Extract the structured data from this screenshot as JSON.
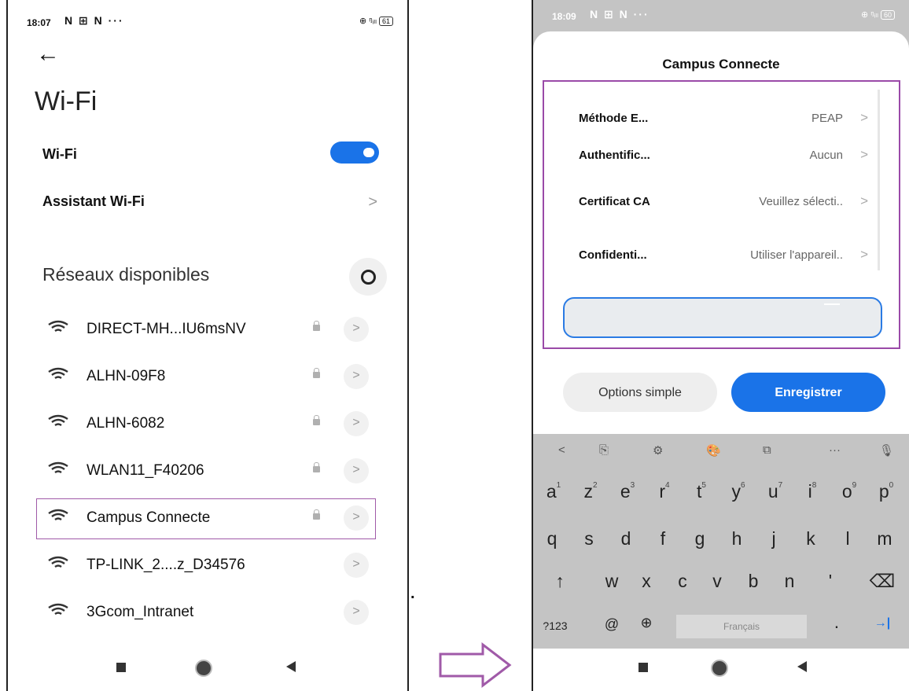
{
  "left_phone": {
    "status": {
      "time": "18:07",
      "icons": "N ⊞ N ···",
      "right_icons": "⊕ ᵑᵢₗₗ",
      "battery": "61"
    },
    "back_label": "←",
    "title": "Wi-Fi",
    "wifi_row": {
      "label": "Wi-Fi",
      "enabled": true
    },
    "assistant": {
      "label": "Assistant Wi-Fi",
      "chevron": ">"
    },
    "networks_title": "Réseaux disponibles",
    "networks": [
      {
        "name": "DIRECT-MH...IU6msNV",
        "locked": true
      },
      {
        "name": "ALHN-09F8",
        "locked": true
      },
      {
        "name": "ALHN-6082",
        "locked": true
      },
      {
        "name": "WLAN11_F40206",
        "locked": true
      },
      {
        "name": "Campus Connecte",
        "locked": true
      },
      {
        "name": "TP-LINK_2....z_D34576",
        "locked": false
      },
      {
        "name": "3Gcom_Intranet",
        "locked": false
      }
    ],
    "chevron": ">"
  },
  "right_phone": {
    "status": {
      "time": "18:09",
      "icons": "N ⊞ N ···",
      "right_icons": "⊕ ᵑᵢₗₗ",
      "battery": "60"
    },
    "dialog_title": "Campus Connecte",
    "fields": [
      {
        "label": "Méthode E...",
        "value": "PEAP"
      },
      {
        "label": "Authentific...",
        "value": "Aucun"
      },
      {
        "label": "Certificat CA",
        "value": "Veuillez sélecti.."
      },
      {
        "label": "Confidenti...",
        "value": "Utiliser l'appareil.."
      }
    ],
    "chevron": ">",
    "options_button": "Options simple",
    "save_button": "Enregistrer",
    "keyboard": {
      "toolbar": [
        "<",
        "⎘",
        "⚙",
        "🎨",
        "⧉",
        "···",
        "🎙"
      ],
      "row1": [
        {
          "k": "a",
          "n": "1"
        },
        {
          "k": "z",
          "n": "2"
        },
        {
          "k": "e",
          "n": "3"
        },
        {
          "k": "r",
          "n": "4"
        },
        {
          "k": "t",
          "n": "5"
        },
        {
          "k": "y",
          "n": "6"
        },
        {
          "k": "u",
          "n": "7"
        },
        {
          "k": "i",
          "n": "8"
        },
        {
          "k": "o",
          "n": "9"
        },
        {
          "k": "p",
          "n": "0"
        }
      ],
      "row2": [
        "q",
        "s",
        "d",
        "f",
        "g",
        "h",
        "j",
        "k",
        "l",
        "m"
      ],
      "row3": [
        "↑",
        "w",
        "x",
        "c",
        "v",
        "b",
        "n",
        "'",
        "⌫"
      ],
      "row4": {
        "num": "?123",
        "at": "@",
        "globe": "⊕",
        "space": "Français",
        "period": ".",
        "enter": "→|"
      }
    }
  },
  "colors": {
    "accent": "#1a73e8",
    "highlight": "#9a4aa8"
  }
}
